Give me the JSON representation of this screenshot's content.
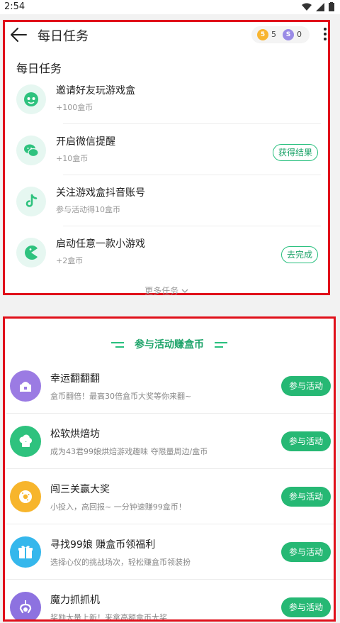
{
  "status_bar": {
    "time": "2:54"
  },
  "header": {
    "title": "每日任务",
    "gold_coins": "5",
    "silver_coins": "0",
    "gold_symbol": "5",
    "silver_symbol": "S"
  },
  "daily": {
    "section_title": "每日任务",
    "tasks": [
      {
        "name": "邀请好友玩游戏盒",
        "reward": "+100盒币",
        "button": ""
      },
      {
        "name": "开启微信提醒",
        "reward": "+10盒币",
        "button": "获得结果"
      },
      {
        "name": "关注游戏盒抖音账号",
        "reward": "参与活动得10盒币",
        "button": ""
      },
      {
        "name": "启动任意一款小游戏",
        "reward": "+2盒币",
        "button": "去完成"
      }
    ],
    "more_tasks": "更多任务"
  },
  "activities": {
    "section_title": "参与活动赚盒币",
    "items": [
      {
        "name": "幸运翻翻翻",
        "desc": "盒币翻倍！最高30倍盒币大奖等你来翻~",
        "button": "参与活动",
        "color": "#9b7be3"
      },
      {
        "name": "松软烘焙坊",
        "desc": "成为43君99娘烘焙游戏趣味 夺限量周边/盒币",
        "button": "参与活动",
        "color": "#2ec27e"
      },
      {
        "name": "闯三关赢大奖",
        "desc": "小投入，高回报~ 一分钟速赚99盒币！",
        "button": "参与活动",
        "color": "#f7b52c"
      },
      {
        "name": "寻找99娘 赚盒币领福利",
        "desc": "选择心仪的挑战场次，轻松赚盒币领装扮",
        "button": "参与活动",
        "color": "#35b7ec"
      },
      {
        "name": "魔力抓抓机",
        "desc": "奖励大量上新！来拿高额盒币大奖",
        "button": "参与活动",
        "color": "#8d72e0"
      }
    ]
  },
  "colors": {
    "accent": "#26b874",
    "highlight_border": "#e0101a"
  }
}
